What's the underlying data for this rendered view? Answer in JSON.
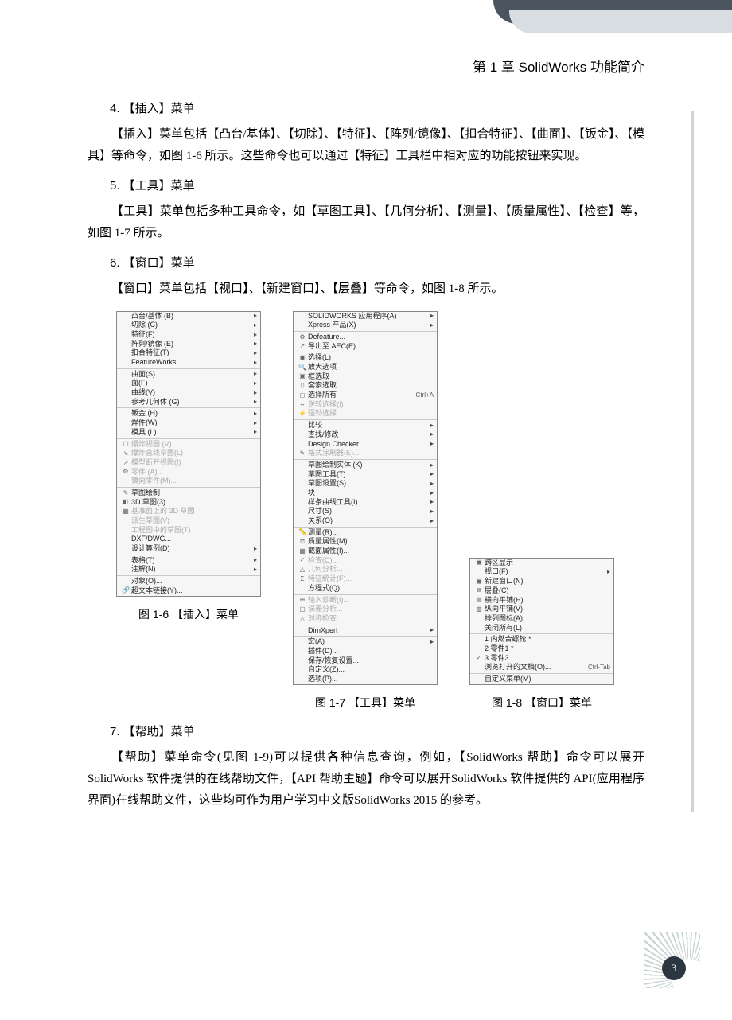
{
  "chapter_header": "第 1 章    SolidWorks 功能简介",
  "s4": {
    "title": "4. 【插入】菜单",
    "para": "【插入】菜单包括【凸台/基体】、【切除】、【特征】、【阵列/镜像】、【扣合特征】、【曲面】、【钣金】、【模具】等命令，如图 1-6 所示。这些命令也可以通过【特征】工具栏中相对应的功能按钮来实现。"
  },
  "s5": {
    "title": "5. 【工具】菜单",
    "para": "【工具】菜单包括多种工具命令，如【草图工具】、【几何分析】、【测量】、【质量属性】、【检查】等，如图 1-7 所示。"
  },
  "s6": {
    "title": "6. 【窗口】菜单",
    "para": "【窗口】菜单包括【视口】、【新建窗口】、【层叠】等命令，如图 1-8 所示。"
  },
  "fig1_6": {
    "caption": "图 1-6   【插入】菜单",
    "items": [
      {
        "icon": "",
        "label": "凸台/基体 (B)",
        "sub": true
      },
      {
        "icon": "",
        "label": "切除 (C)",
        "sub": true
      },
      {
        "icon": "",
        "label": "特征(F)",
        "sub": true
      },
      {
        "icon": "",
        "label": "阵列/镜像 (E)",
        "sub": true
      },
      {
        "icon": "",
        "label": "扣合特征(T)",
        "sub": true
      },
      {
        "icon": "",
        "label": "FeatureWorks",
        "sub": true
      },
      {
        "sep": true
      },
      {
        "icon": "",
        "label": "曲面(S)",
        "sub": true
      },
      {
        "icon": "",
        "label": "面(F)",
        "sub": true
      },
      {
        "icon": "",
        "label": "曲线(V)",
        "sub": true
      },
      {
        "icon": "",
        "label": "参考几何体 (G)",
        "sub": true
      },
      {
        "sep": true
      },
      {
        "icon": "",
        "label": "钣金 (H)",
        "sub": true
      },
      {
        "icon": "",
        "label": "焊件(W)",
        "sub": true
      },
      {
        "icon": "",
        "label": "模具 (L)",
        "sub": true
      },
      {
        "sep": true
      },
      {
        "icon": "▢",
        "label": "爆炸视图 (V)...",
        "dis": true
      },
      {
        "icon": "↘",
        "label": "爆炸直线草图(L)",
        "dis": true
      },
      {
        "icon": "↗",
        "label": "模型断开视图(I)",
        "dis": true
      },
      {
        "icon": "⚙",
        "label": "零件 (A)...",
        "dis": true
      },
      {
        "icon": "",
        "label": "镜向零件(M)...",
        "dis": true
      },
      {
        "sep": true
      },
      {
        "icon": "✎",
        "label": "草图绘制"
      },
      {
        "icon": "◧",
        "label": "3D 草图(3)"
      },
      {
        "icon": "▦",
        "label": "基准面上的 3D 草图",
        "dis": true
      },
      {
        "icon": "",
        "label": "派生草图(V)",
        "dis": true
      },
      {
        "icon": "",
        "label": "工程图中的草图(T)",
        "dis": true
      },
      {
        "icon": "",
        "label": "DXF/DWG..."
      },
      {
        "icon": "",
        "label": "设计算例(D)",
        "sub": true
      },
      {
        "sep": true
      },
      {
        "icon": "",
        "label": "表格(T)",
        "sub": true
      },
      {
        "icon": "",
        "label": "注解(N)",
        "sub": true
      },
      {
        "sep": true
      },
      {
        "icon": "",
        "label": "对象(O)..."
      },
      {
        "icon": "🔗",
        "label": "超文本链接(Y)..."
      }
    ]
  },
  "fig1_7": {
    "caption": "图 1-7   【工具】菜单",
    "items": [
      {
        "icon": "",
        "label": "SOLIDWORKS 应用程序(A)",
        "sub": true
      },
      {
        "icon": "",
        "label": "Xpress 产品(X)",
        "sub": true
      },
      {
        "sep": true
      },
      {
        "icon": "⚙",
        "label": "Defeature..."
      },
      {
        "icon": "↗",
        "label": "导出至 AEC(E)..."
      },
      {
        "sep": true
      },
      {
        "icon": "▣",
        "label": "选择(L)"
      },
      {
        "icon": "🔍",
        "label": "放大选项"
      },
      {
        "icon": "▣",
        "label": "框选取"
      },
      {
        "icon": "⬯",
        "label": "套索选取"
      },
      {
        "icon": "◻",
        "label": "选择所有",
        "shortcut": "Ctrl+A"
      },
      {
        "icon": "↔",
        "label": "逆转选择(I)",
        "dis": true
      },
      {
        "icon": "⚡",
        "label": "强劲选择",
        "dis": true
      },
      {
        "sep": true
      },
      {
        "icon": "",
        "label": "比较",
        "sub": true
      },
      {
        "icon": "",
        "label": "查找/修改",
        "sub": true
      },
      {
        "icon": "",
        "label": "Design Checker",
        "sub": true
      },
      {
        "icon": "✎",
        "label": "格式涂刷器(E)...",
        "dis": true
      },
      {
        "sep": true
      },
      {
        "icon": "",
        "label": "草图绘制实体 (K)",
        "sub": true
      },
      {
        "icon": "",
        "label": "草图工具(T)",
        "sub": true
      },
      {
        "icon": "",
        "label": "草图设置(S)",
        "sub": true
      },
      {
        "icon": "",
        "label": "块",
        "sub": true
      },
      {
        "icon": "",
        "label": "样条曲线工具(I)",
        "sub": true
      },
      {
        "icon": "",
        "label": "尺寸(S)",
        "sub": true
      },
      {
        "icon": "",
        "label": "关系(O)",
        "sub": true
      },
      {
        "sep": true
      },
      {
        "icon": "📏",
        "label": "测量(R)..."
      },
      {
        "icon": "⚖",
        "label": "质量属性(M)..."
      },
      {
        "icon": "▦",
        "label": "截面属性(I)..."
      },
      {
        "icon": "✓",
        "label": "检查(C)...",
        "dis": true
      },
      {
        "icon": "△",
        "label": "几何分析...",
        "dis": true
      },
      {
        "icon": "Σ",
        "label": "特征统计(F)...",
        "dis": true
      },
      {
        "icon": "",
        "label": "方程式(Q)..."
      },
      {
        "sep": true
      },
      {
        "icon": "⊕",
        "label": "输入诊断(I)...",
        "dis": true
      },
      {
        "icon": "▢",
        "label": "误差分析...",
        "dis": true
      },
      {
        "icon": "△",
        "label": "对称检查",
        "dis": true
      },
      {
        "sep": true
      },
      {
        "icon": "",
        "label": "DimXpert",
        "sub": true
      },
      {
        "sep": true
      },
      {
        "icon": "",
        "label": "宏(A)",
        "sub": true
      },
      {
        "icon": "",
        "label": "插件(D)..."
      },
      {
        "icon": "",
        "label": "保存/恢复设置..."
      },
      {
        "icon": "",
        "label": "自定义(Z)..."
      },
      {
        "icon": "",
        "label": "选项(P)..."
      }
    ]
  },
  "fig1_8": {
    "caption": "图 1-8   【窗口】菜单",
    "items": [
      {
        "icon": "▣",
        "label": "跨区显示"
      },
      {
        "icon": "",
        "label": "视口(F)",
        "sub": true
      },
      {
        "icon": "▣",
        "label": "新建窗口(N)"
      },
      {
        "icon": "⧉",
        "label": "层叠(C)"
      },
      {
        "icon": "▤",
        "label": "横向平铺(H)"
      },
      {
        "icon": "▥",
        "label": "纵向平铺(V)"
      },
      {
        "icon": "",
        "label": "排列图标(A)"
      },
      {
        "icon": "",
        "label": "关闭所有(L)"
      },
      {
        "sep": true
      },
      {
        "icon": "",
        "label": "1 内燃合螺轮 *",
        "check": true
      },
      {
        "icon": "",
        "label": "2 零件1 *"
      },
      {
        "icon": "✓",
        "label": "3 零件3"
      },
      {
        "icon": "",
        "label": "浏览打开的文档(O)...",
        "shortcut": "Ctrl-Tab"
      },
      {
        "sep": true
      },
      {
        "icon": "",
        "label": "自定义菜单(M)"
      }
    ]
  },
  "s7": {
    "title": "7. 【帮助】菜单",
    "para": "【帮助】菜单命令(见图 1-9)可以提供各种信息查询，例如，【SolidWorks 帮助】命令可以展开 SolidWorks 软件提供的在线帮助文件，【API 帮助主题】命令可以展开SolidWorks 软件提供的 API(应用程序界面)在线帮助文件，这些均可作为用户学习中文版SolidWorks 2015 的参考。"
  },
  "page_number": "3"
}
